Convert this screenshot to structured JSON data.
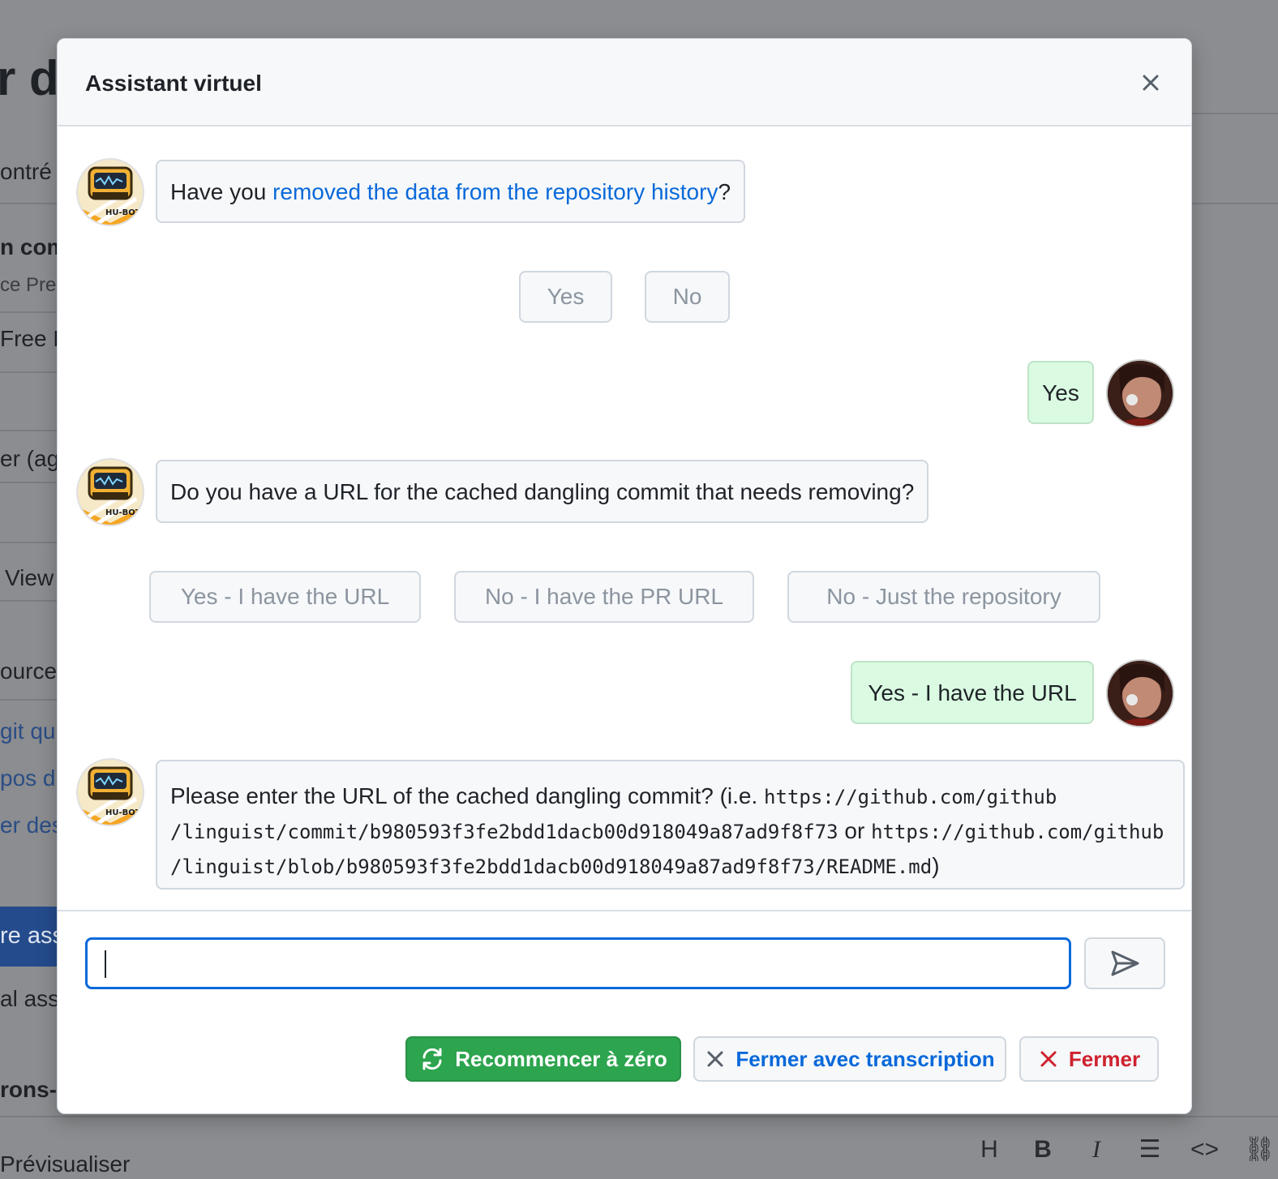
{
  "background": {
    "heading_fragment": "r de",
    "fragments": [
      "ontré",
      "n com",
      "ce Prer",
      "Free F",
      "er (ag",
      "View",
      "ources",
      "git qu",
      "pos d",
      "er des",
      "re ass",
      "al assi",
      "rons-n",
      "Prévisualiser"
    ],
    "toolbar_icons": [
      "heading-icon",
      "bold-icon",
      "italic-icon",
      "list-icon",
      "code-icon",
      "link-icon"
    ],
    "toolbar_glyphs": [
      "H",
      "B",
      "I",
      "☰",
      "<>",
      "⛓"
    ]
  },
  "modal": {
    "title": "Assistant virtuel",
    "close_label": "×"
  },
  "messages": {
    "m1": {
      "prefix": "Have you ",
      "link": "removed the data from the repository history",
      "suffix": "?"
    },
    "m1_options": [
      "Yes",
      "No"
    ],
    "u1": "Yes",
    "m2": "Do you have a URL for the cached dangling commit that needs removing?",
    "m2_options": [
      "Yes - I have the URL",
      "No - I have the PR URL",
      "No - Just the repository"
    ],
    "u2": "Yes - I have the URL",
    "m3": {
      "text1": "Please enter the URL of the cached dangling commit? (i.e. ",
      "code1a": "https://github.com/github",
      "code1b": "/linguist/commit/b980593f3fe2bdd1dacb00d918049a87ad9f8f73",
      "text2": " or ",
      "code2a": "https://github.com/github",
      "code2b": "/linguist/blob/b980593f3fe2bdd1dacb00d918049a87ad9f8f73/README.md",
      "text3": ")"
    },
    "bot_badge": "HU-BOT"
  },
  "input": {
    "value": "",
    "placeholder": ""
  },
  "footer": {
    "restart_label": "Recommencer à zéro",
    "transcript_label": "Fermer avec transcription",
    "close_label": "Fermer"
  },
  "colors": {
    "accent": "#0969da",
    "success": "#2da44e",
    "danger": "#cf222e",
    "user_bubble": "#dafbe1"
  }
}
